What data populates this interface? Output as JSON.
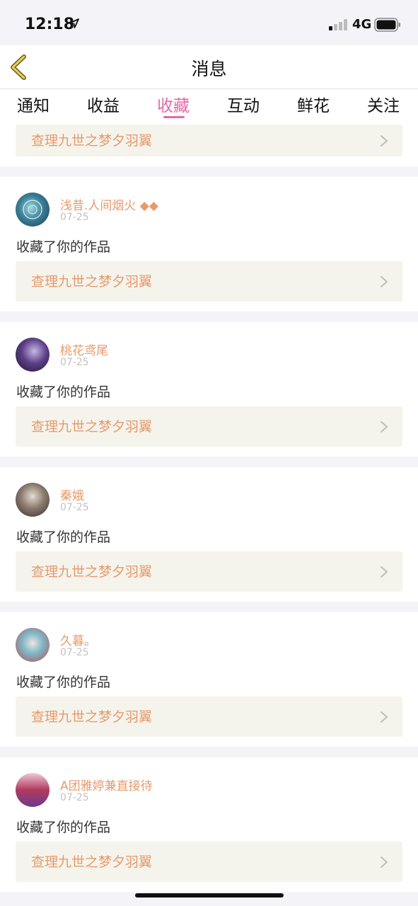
{
  "status": {
    "time": "12:18",
    "network": "4G"
  },
  "nav": {
    "title": "消息"
  },
  "tabs": [
    {
      "label": "通知"
    },
    {
      "label": "收益"
    },
    {
      "label": "收藏"
    },
    {
      "label": "互动"
    },
    {
      "label": "鲜花"
    },
    {
      "label": "关注"
    }
  ],
  "active_tab": "收藏",
  "top_partial": {
    "work_title": "查理九世之梦夕羽翼"
  },
  "items": [
    {
      "user": "浅昔.人间烟火 ◆◆",
      "date": "07-25",
      "action": "收藏了你的作品",
      "work_title": "查理九世之梦夕羽翼"
    },
    {
      "user": "桃花鸢尾",
      "date": "07-25",
      "action": "收藏了你的作品",
      "work_title": "查理九世之梦夕羽翼"
    },
    {
      "user": "秦娥",
      "date": "07-25",
      "action": "收藏了你的作品",
      "work_title": "查理九世之梦夕羽翼"
    },
    {
      "user": "久暮。",
      "date": "07-25",
      "action": "收藏了你的作品",
      "work_title": "查理九世之梦夕羽翼"
    },
    {
      "user": "A团雅婷兼直接待",
      "date": "07-25",
      "action": "收藏了你的作品",
      "work_title": "查理九世之梦夕羽翼"
    }
  ],
  "colors": {
    "accent": "#e46aa5",
    "username": "#e79a6b",
    "card_bg": "#f4f4ec"
  }
}
